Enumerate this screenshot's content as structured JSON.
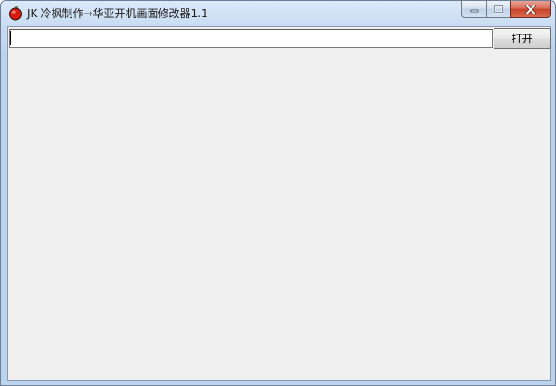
{
  "window": {
    "title": "JK-冷枫制作→华亚开机画面修改器1.1"
  },
  "toolbar": {
    "path_value": "",
    "open_label": "打开"
  },
  "colors": {
    "title_bar": "#c9dcf2",
    "client_bg": "#f0f0f0",
    "close_button": "#c7432b",
    "app_icon": "#d81b10"
  }
}
